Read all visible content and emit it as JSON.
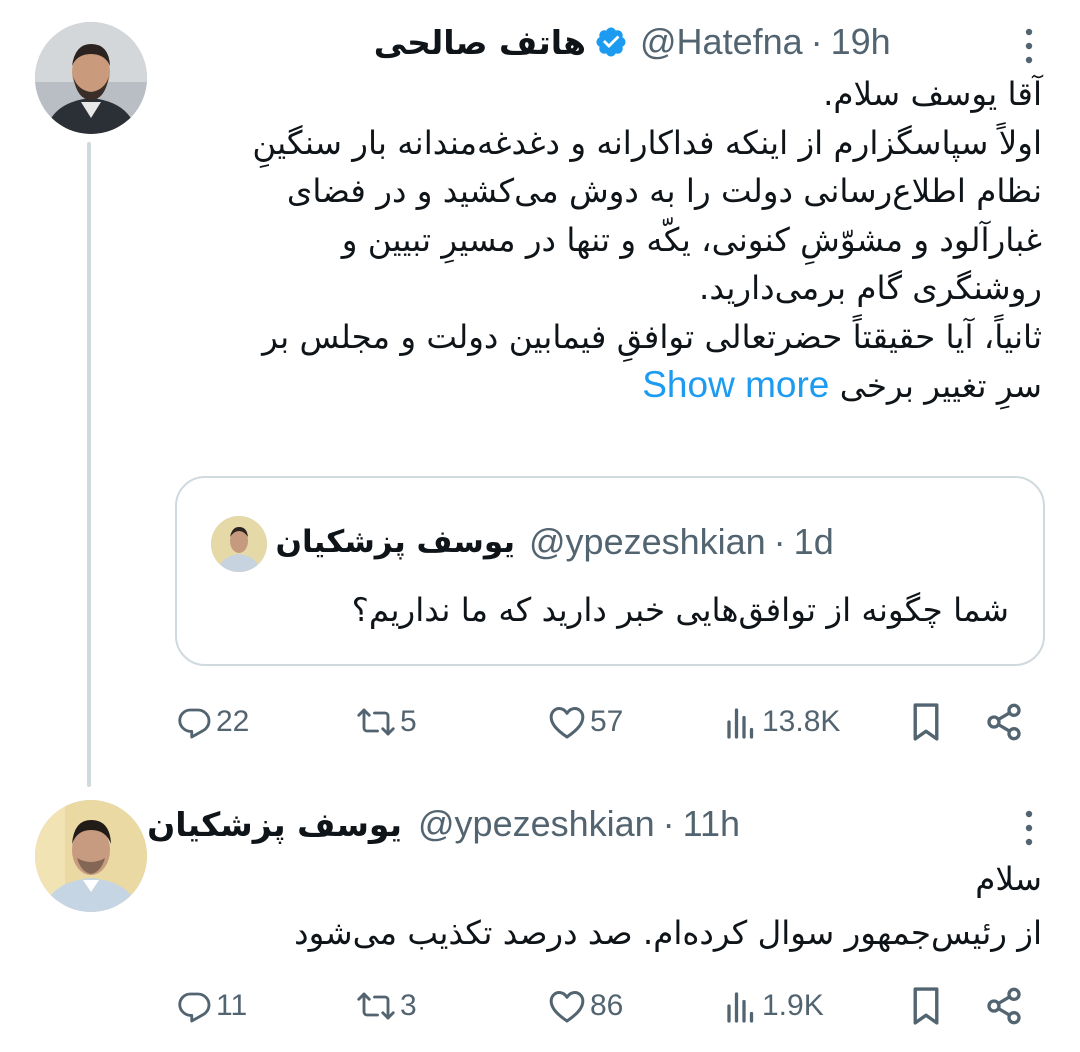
{
  "tweets": [
    {
      "author_name": "هاتف صالحی",
      "handle": "@Hatefna",
      "time": "19h",
      "text_lines": [
        "آقا یوسف سلام.",
        "اولاً سپاسگزارم از اینکه فداکارانه و دغدغه‌مندانه بار سنگینِ",
        "نظام اطلاع‌رسانی دولت را به دوش می‌کشید و در فضای",
        "غبارآلود و مشوّشِ کنونی، یکّه و تنها در مسیرِ تبیین و",
        "روشنگری گام برمی‌دارید.",
        "ثانیاً، آیا حقیقتاً حضرتعالی توافقِ فیمابین دولت و مجلس بر",
        "سرِ تغییر برخی"
      ],
      "show_more": "Show more",
      "quote": {
        "author_name": "یوسف پزشکیان",
        "handle": "@ypezeshkian",
        "time": "1d",
        "text": "شما چگونه از توافق‌هایی خبر دارید که ما نداریم؟"
      },
      "metrics": {
        "replies": "22",
        "reposts": "5",
        "likes": "57",
        "views": "13.8K"
      }
    },
    {
      "author_name": "یوسف پزشکیان",
      "handle": "@ypezeshkian",
      "time": "11h",
      "text_lines": [
        "سلام",
        "از رئیس‌جمهور سوال کرده‌ام. صد درصد تکذیب می‌شود"
      ],
      "metrics": {
        "replies": "11",
        "reposts": "3",
        "likes": "86",
        "views": "1.9K"
      }
    }
  ],
  "icons": [
    "verified-badge-icon",
    "more-icon",
    "reply-icon",
    "repost-icon",
    "like-icon",
    "views-icon",
    "bookmark-icon",
    "share-icon"
  ],
  "colors": {
    "link": "#1d9bf0",
    "secondary_text": "#536471",
    "border": "#cfd9de",
    "verified": "#1d9bf0"
  }
}
